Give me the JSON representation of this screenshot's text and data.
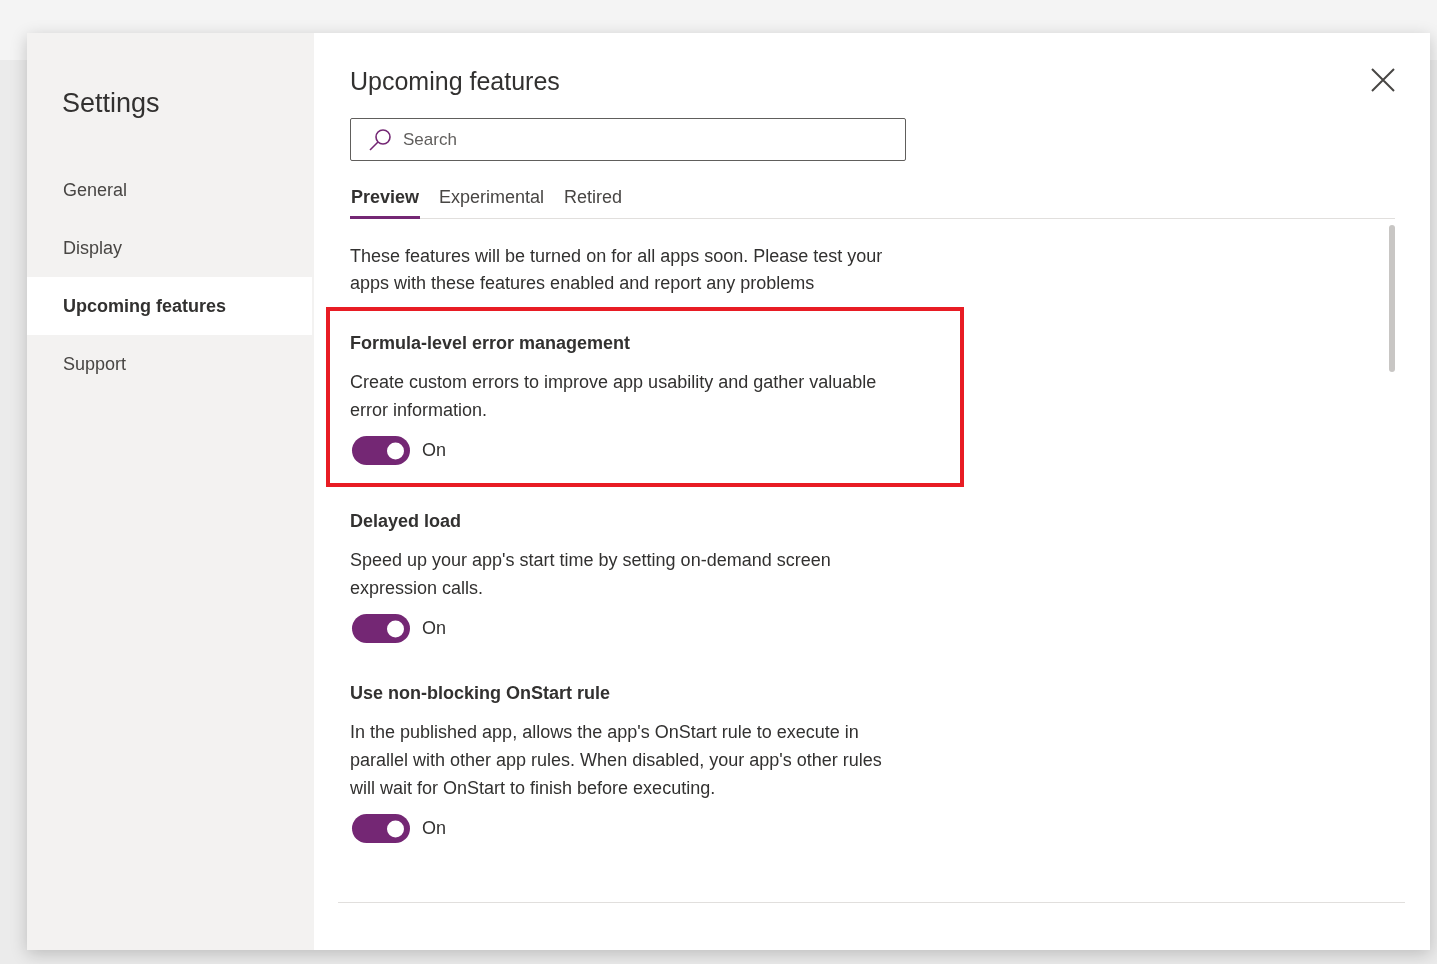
{
  "sidebar": {
    "title": "Settings",
    "items": [
      {
        "label": "General",
        "selected": false
      },
      {
        "label": "Display",
        "selected": false
      },
      {
        "label": "Upcoming features",
        "selected": true
      },
      {
        "label": "Support",
        "selected": false
      }
    ]
  },
  "panel": {
    "title": "Upcoming features",
    "search": {
      "placeholder": "Search"
    },
    "tabs": [
      {
        "label": "Preview",
        "selected": true
      },
      {
        "label": "Experimental",
        "selected": false
      },
      {
        "label": "Retired",
        "selected": false
      }
    ],
    "intro": "These features will be turned on for all apps soon. Please test your apps with these features enabled and report any problems",
    "features": [
      {
        "title": "Formula-level error management",
        "description": "Create custom errors to improve app usability and gather valuable error information.",
        "on": true,
        "toggle_label": "On",
        "highlighted": true
      },
      {
        "title": "Delayed load",
        "description": "Speed up your app's start time by setting on-demand screen expression calls.",
        "on": true,
        "toggle_label": "On",
        "highlighted": false
      },
      {
        "title": "Use non-blocking OnStart rule",
        "description": "In the published app, allows the app's OnStart rule to execute in parallel with other app rules. When disabled, your app's other rules will wait for OnStart to finish before executing.",
        "on": true,
        "toggle_label": "On",
        "highlighted": false
      }
    ]
  }
}
